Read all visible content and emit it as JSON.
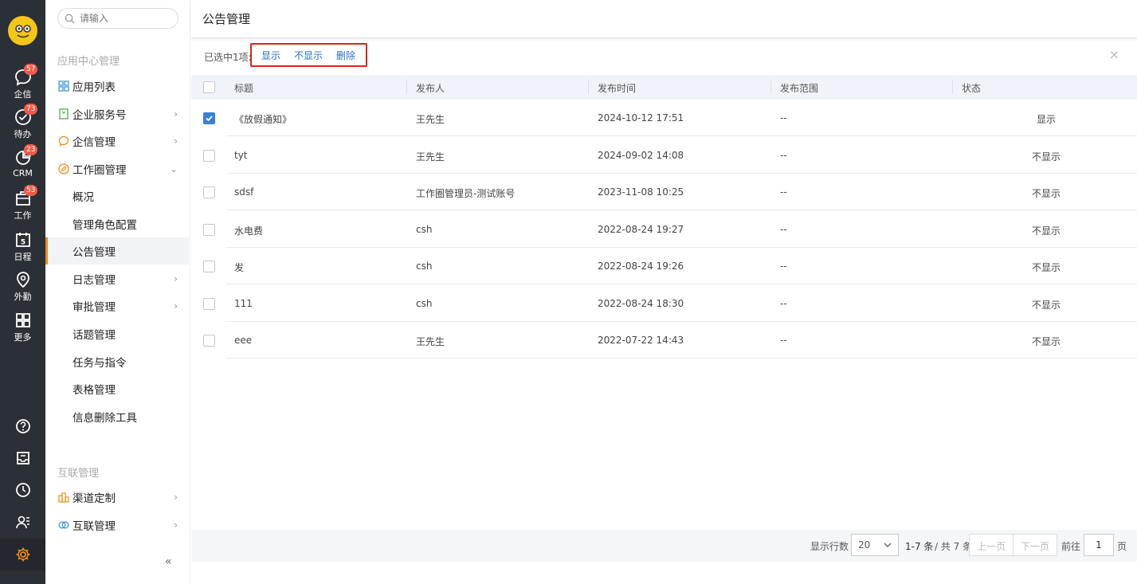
{
  "rail": {
    "items": [
      {
        "label": "企信",
        "badge": "57"
      },
      {
        "label": "待办",
        "badge": "73"
      },
      {
        "label": "CRM",
        "badge": "23"
      },
      {
        "label": "工作",
        "badge": "53"
      },
      {
        "label": "日程",
        "badge": ""
      },
      {
        "label": "外勤",
        "badge": ""
      },
      {
        "label": "更多",
        "badge": ""
      }
    ],
    "calendar_day": "5"
  },
  "sidebar": {
    "search_placeholder": "请输入",
    "section1": "应用中心管理",
    "items": [
      {
        "label": "应用列表"
      },
      {
        "label": "企业服务号"
      },
      {
        "label": "企信管理"
      },
      {
        "label": "工作圈管理"
      },
      {
        "label": "概况"
      },
      {
        "label": "管理角色配置"
      },
      {
        "label": "公告管理"
      },
      {
        "label": "日志管理"
      },
      {
        "label": "审批管理"
      },
      {
        "label": "话题管理"
      },
      {
        "label": "任务与指令"
      },
      {
        "label": "表格管理"
      },
      {
        "label": "信息删除工具"
      }
    ],
    "section2": "互联管理",
    "items2": [
      {
        "label": "渠道定制"
      },
      {
        "label": "互联管理"
      }
    ],
    "collapse": "«"
  },
  "main": {
    "title": "公告管理",
    "selected_text": "已选中1项:",
    "actions": {
      "show": "显示",
      "hide": "不显示",
      "delete": "删除"
    },
    "close": "×",
    "columns": [
      "标题",
      "发布人",
      "发布时间",
      "发布范围",
      "状态"
    ],
    "rows": [
      {
        "title": "《放假通知》",
        "publisher": "王先生",
        "time": "2024-10-12 17:51",
        "scope": "--",
        "status": "显示",
        "checked": true
      },
      {
        "title": "tyt",
        "publisher": "王先生",
        "time": "2024-09-02 14:08",
        "scope": "--",
        "status": "不显示",
        "checked": false
      },
      {
        "title": "sdsf",
        "publisher": "工作圈管理员-测试账号",
        "time": "2023-11-08 10:25",
        "scope": "--",
        "status": "不显示",
        "checked": false
      },
      {
        "title": "水电费",
        "publisher": "csh",
        "time": "2022-08-24 19:27",
        "scope": "--",
        "status": "不显示",
        "checked": false
      },
      {
        "title": "发",
        "publisher": "csh",
        "time": "2022-08-24 19:26",
        "scope": "--",
        "status": "不显示",
        "checked": false
      },
      {
        "title": "111",
        "publisher": "csh",
        "time": "2022-08-24 18:30",
        "scope": "--",
        "status": "不显示",
        "checked": false
      },
      {
        "title": "eee",
        "publisher": "王先生",
        "time": "2022-07-22 14:43",
        "scope": "--",
        "status": "不显示",
        "checked": false
      }
    ]
  },
  "pagination": {
    "rows_label": "显示行数",
    "page_size": "20",
    "range": "1-7 条",
    "total": "/ 共 7 条",
    "prev": "上一页",
    "next": "下一页",
    "goto": "前往",
    "page": "1",
    "page_unit": "页"
  }
}
